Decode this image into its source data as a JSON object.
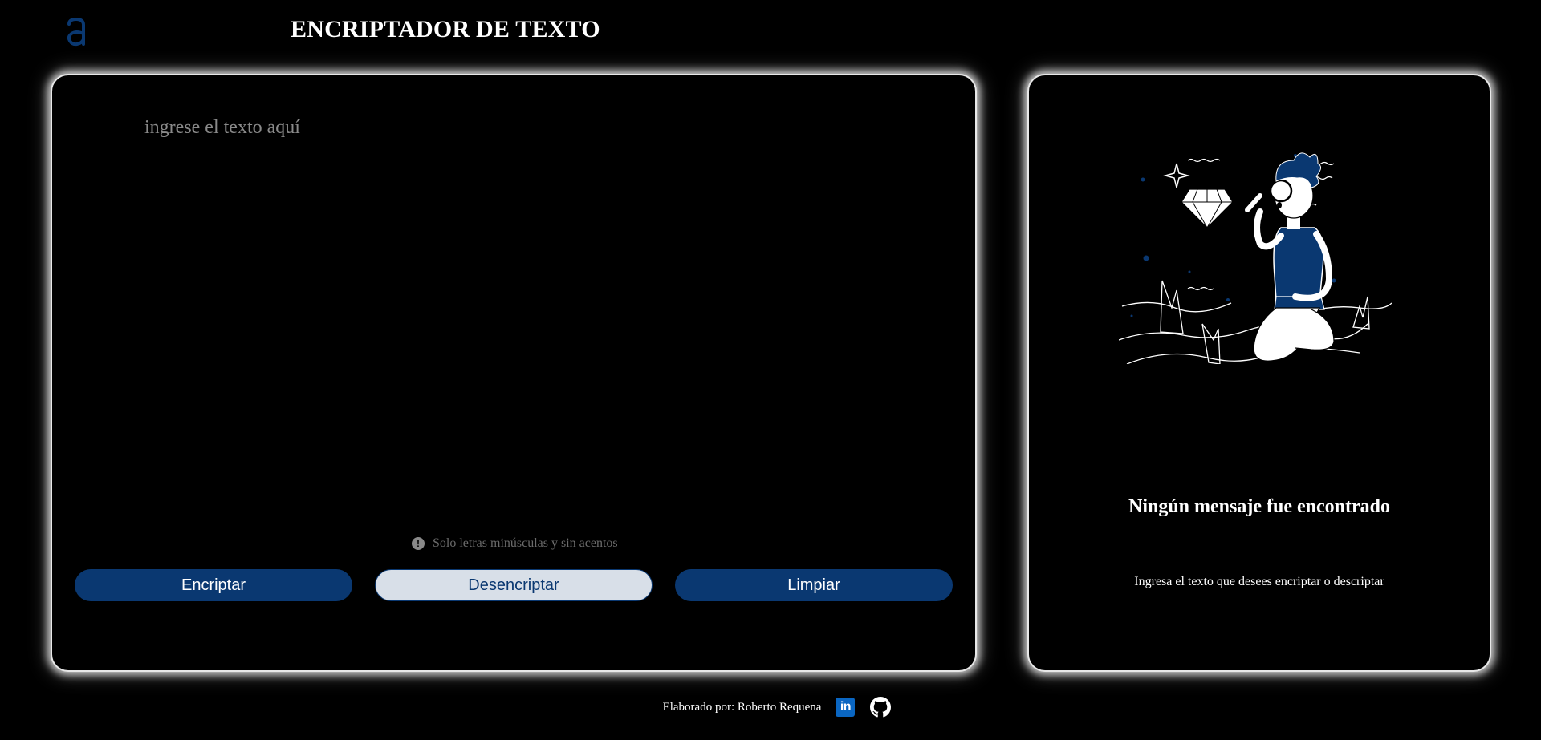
{
  "header": {
    "logo_icon": "alura-logo-icon",
    "title": "ENCRIPTADOR DE TEXTO"
  },
  "input_panel": {
    "textarea_placeholder": "ingrese el texto aquí",
    "textarea_value": "",
    "hint_icon": "info-circle-icon",
    "hint_text": "Solo letras minúsculas y sin acentos",
    "buttons": {
      "encrypt": "Encriptar",
      "decrypt": "Desencriptar",
      "clear": "Limpiar"
    }
  },
  "output_panel": {
    "illustration": "person-with-magnifying-glass-illustration",
    "empty_title": "Ningún mensaje fue encontrado",
    "empty_text": "Ingresa el texto que desees encriptar o descriptar"
  },
  "footer": {
    "credit": "Elaborado por: Roberto Requena",
    "linkedin_icon": "linkedin-icon",
    "github_icon": "github-icon"
  },
  "colors": {
    "background": "#000000",
    "primary": "#0a3871",
    "secondary_button": "#d8dfe8",
    "text": "#ffffff",
    "placeholder": "#8a8a8a",
    "hint": "#6b6b6b"
  }
}
